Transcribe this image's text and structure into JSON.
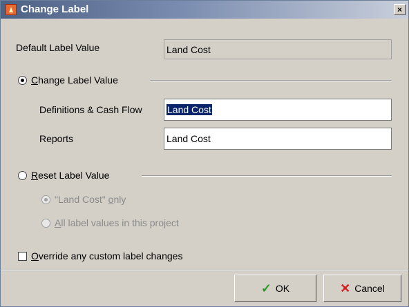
{
  "window": {
    "title": "Change Label",
    "close_glyph": "×"
  },
  "default_label": {
    "caption": "Default Label Value",
    "value": "Land Cost"
  },
  "change_section": {
    "label_first": "C",
    "label_rest": "hange Label Value",
    "selected": true
  },
  "definitions_field": {
    "caption": "Definitions & Cash Flow",
    "value": "Land Cost"
  },
  "reports_field": {
    "caption": "Reports",
    "value": "Land Cost"
  },
  "reset_section": {
    "label_first": "R",
    "label_rest": "eset Label Value",
    "selected": false
  },
  "reset_options": [
    {
      "label_a": "\"Land Cost\" ",
      "label_u": "o",
      "label_b": "nly",
      "selected": true
    },
    {
      "label_a": "",
      "label_u": "A",
      "label_b": "ll label values in this project",
      "selected": false
    }
  ],
  "override": {
    "label_first": "O",
    "label_rest": "verride any custom label changes",
    "checked": false
  },
  "buttons": {
    "ok_label": "OK",
    "cancel_label": "Cancel"
  },
  "icons": {
    "ok": "check-icon",
    "cancel": "x-icon",
    "app": "app-icon"
  }
}
